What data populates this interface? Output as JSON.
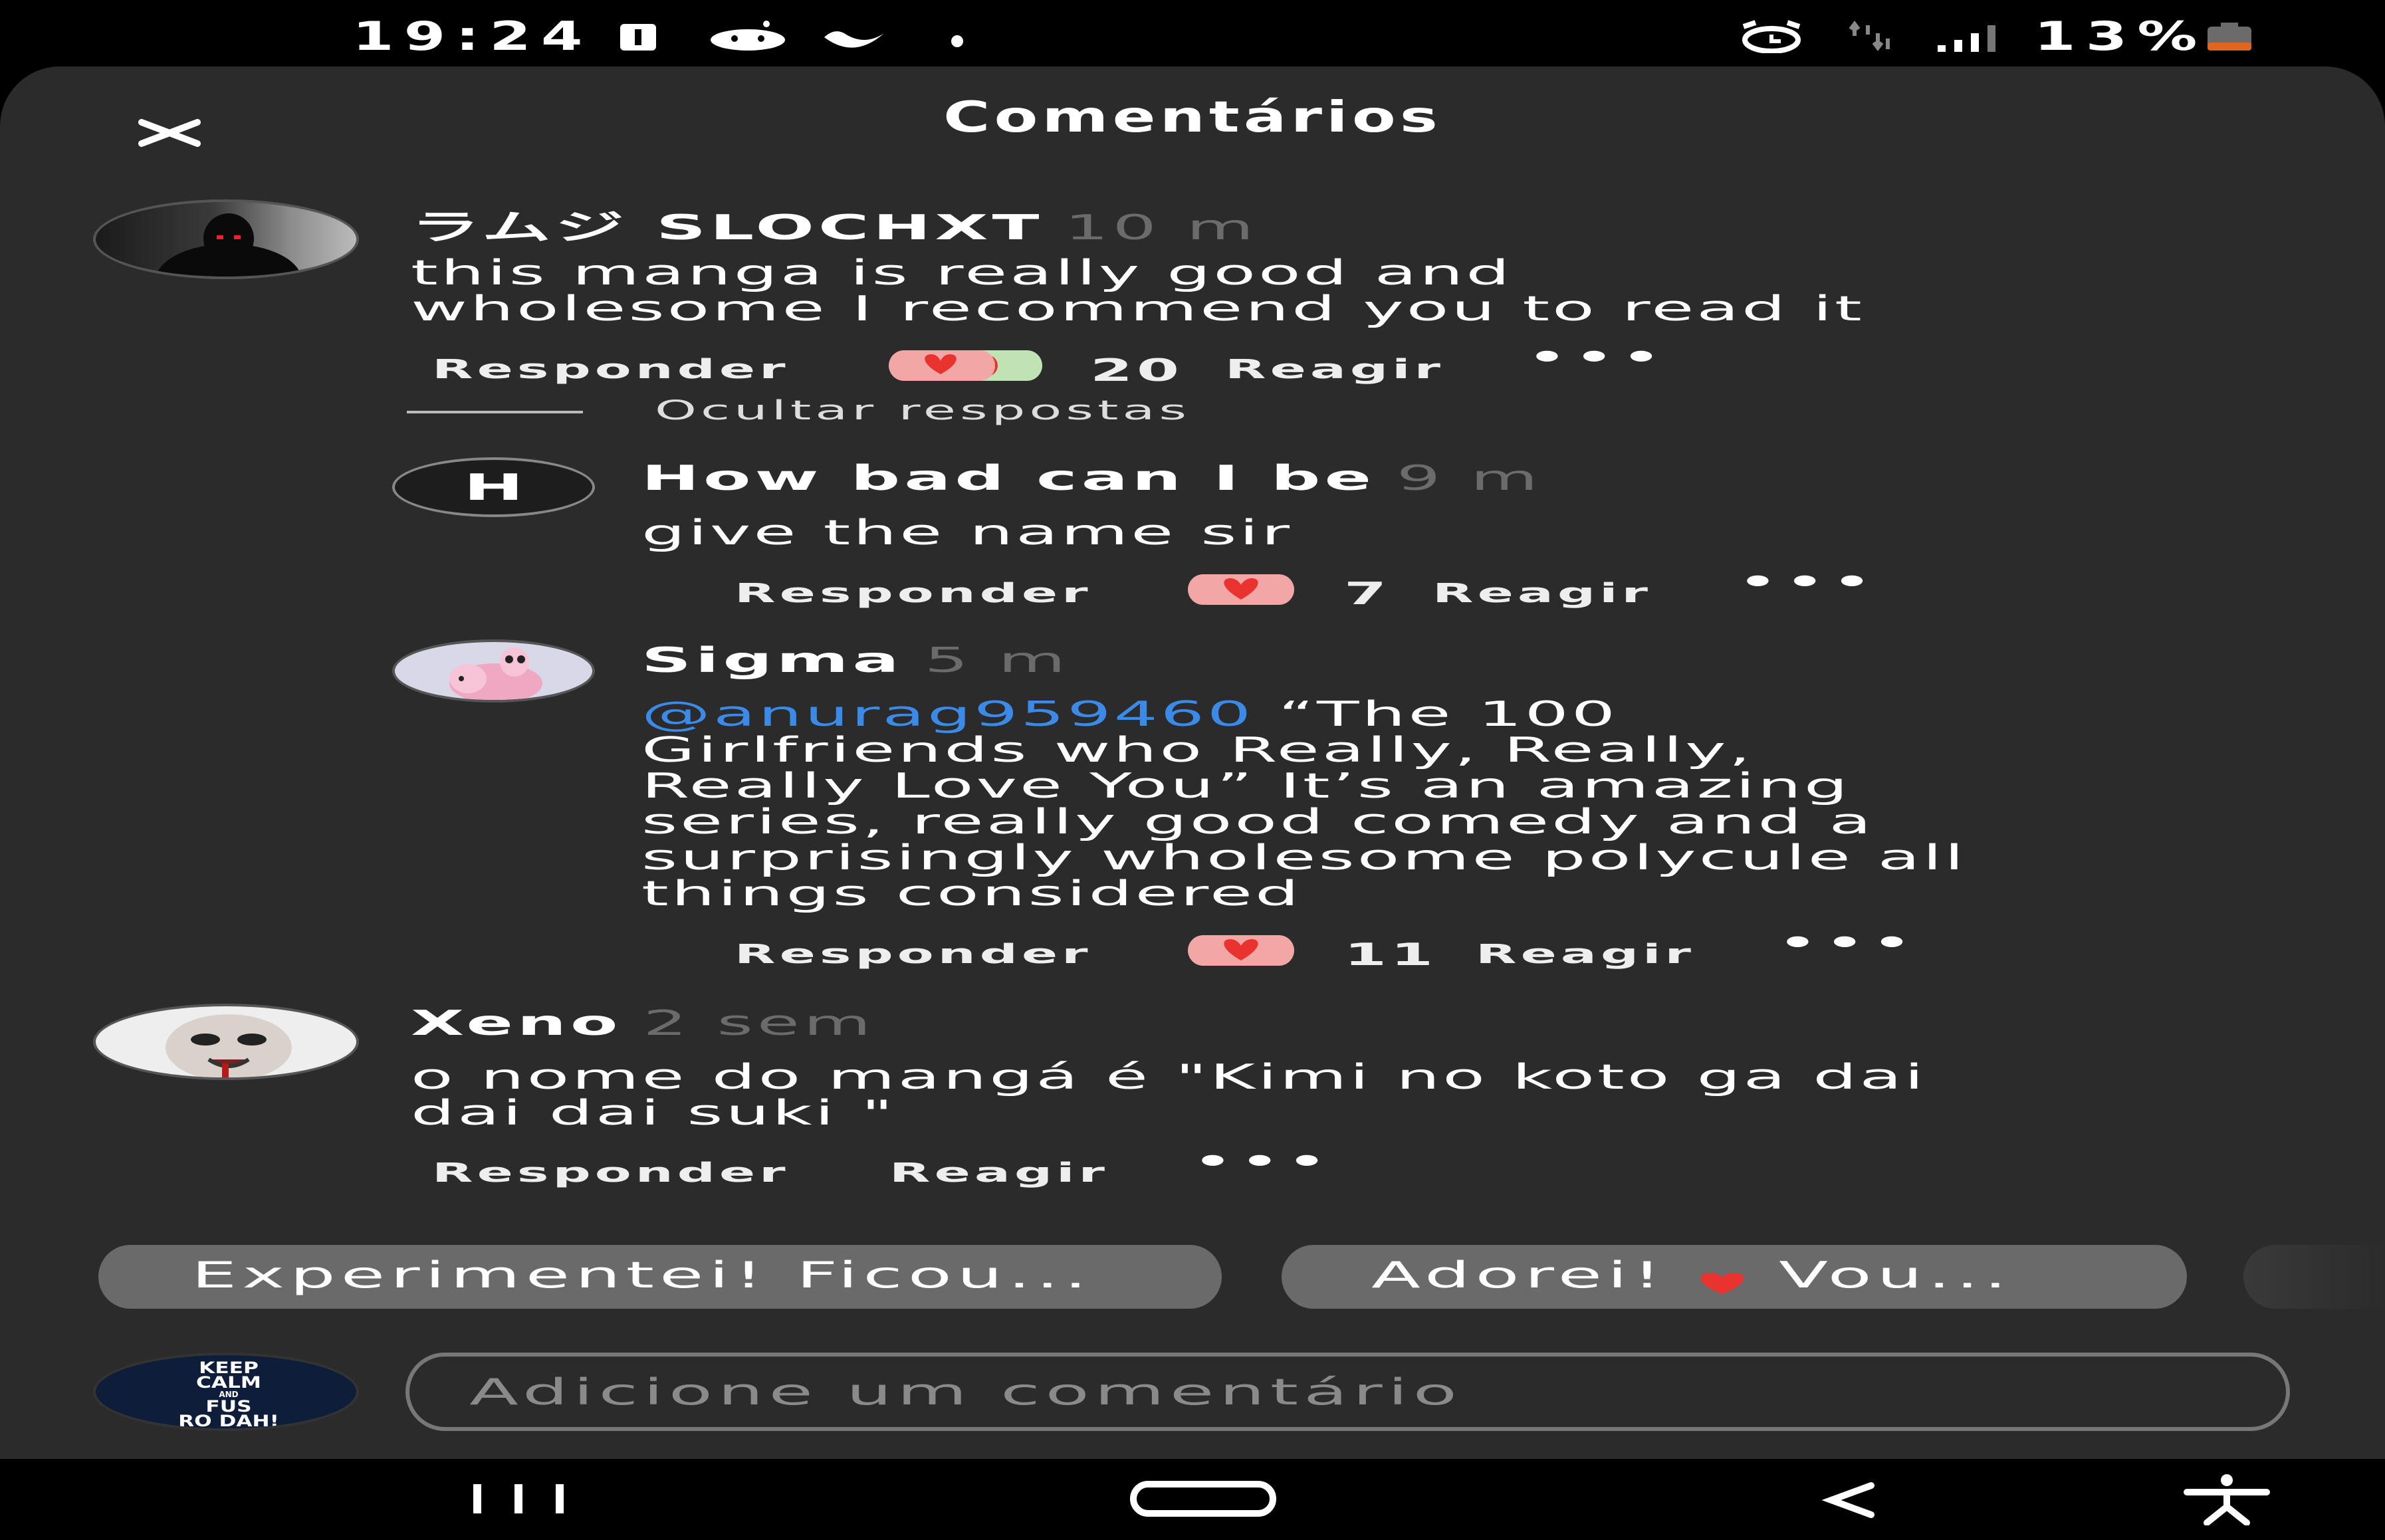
{
  "status_bar": {
    "time": "19:24",
    "battery_percent": "13%",
    "left_icons": [
      "battery-saver-icon",
      "reddit-icon",
      "moon-icon",
      "dot-icon"
    ],
    "right_icons": [
      "alarm-icon",
      "data-arrows-icon",
      "signal-icon",
      "battery-icon"
    ]
  },
  "sheet": {
    "title": "Comentários",
    "close_icon": "close-icon"
  },
  "comments": [
    {
      "author": "ラムジ SLOCHXT",
      "time": "10 m",
      "text_lines": [
        "this manga is really good and",
        "wholesome I recommend you to read it"
      ],
      "reply_label": "Responder",
      "reaction_count": "20",
      "react_label": "Reagir",
      "more_label": "•••",
      "hide_replies_label": "Ocultar respostas"
    },
    {
      "author": "How bad can I be",
      "avatar_letter": "H",
      "time": "9 m",
      "text_lines": [
        "give the name sir"
      ],
      "reply_label": "Responder",
      "reaction_count": "7",
      "react_label": "Reagir",
      "more_label": "•••"
    },
    {
      "author": "Sigma",
      "time": "5 m",
      "mention": "@anurag959460",
      "text_lines": [
        " “The 100",
        "Girlfriends who Really, Really,",
        "Really Love You” It’s an amazing",
        "series, really good comedy and a",
        "surprisingly wholesome polycule all",
        "things considered"
      ],
      "reply_label": "Responder",
      "reaction_count": "11",
      "react_label": "Reagir",
      "more_label": "•••"
    },
    {
      "author": "Xeno",
      "time": "2 sem",
      "text_lines": [
        "o nome do mangá é \"Kimi no koto ga dai",
        "dai dai suki \""
      ],
      "reply_label": "Responder",
      "react_label": "Reagir",
      "more_label": "•••"
    }
  ],
  "quick_replies": [
    {
      "label": "Experimentei! Ficou..."
    },
    {
      "label_a": "Adorei!",
      "label_b": "Vou..."
    }
  ],
  "composer": {
    "placeholder": "Adicione um comentário",
    "avatar_lines": [
      "KEEP",
      "CALM",
      "AND",
      "FUS",
      "RO DAH!"
    ]
  },
  "nav_bar": {
    "icons": [
      "recent-apps-icon",
      "home-icon",
      "back-icon",
      "accessibility-icon"
    ]
  },
  "colors": {
    "background": "#2b2b2b",
    "mention": "#3b8ae8",
    "timestamp": "#6b6b6b",
    "heart": "#e8332f"
  }
}
